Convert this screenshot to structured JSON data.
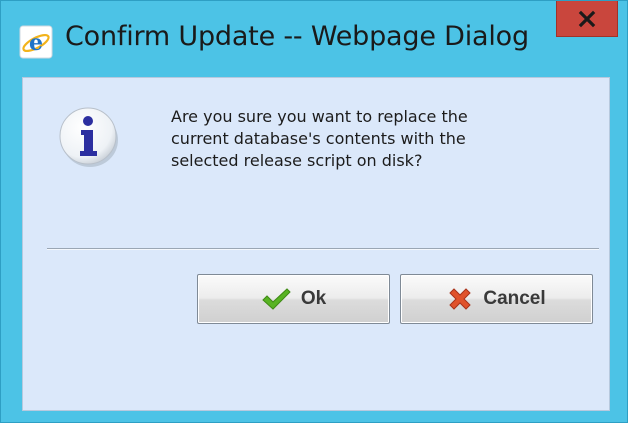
{
  "window": {
    "title": "Confirm Update -- Webpage Dialog",
    "title_icon": "internet-explorer-icon",
    "close_icon": "close-icon"
  },
  "dialog": {
    "icon": "info-icon",
    "message_lines": [
      "Are you sure you want to replace the",
      "current database's contents with the",
      "selected release script on disk?"
    ]
  },
  "buttons": {
    "ok_label": "Ok",
    "ok_icon": "checkmark-icon",
    "cancel_label": "Cancel",
    "cancel_icon": "red-x-icon"
  },
  "colors": {
    "frame": "#4cc3e6",
    "close_button": "#c9463d",
    "client_background": "#dbe8fa",
    "ok_check": "#58b323",
    "cancel_x": "#e0522b"
  }
}
